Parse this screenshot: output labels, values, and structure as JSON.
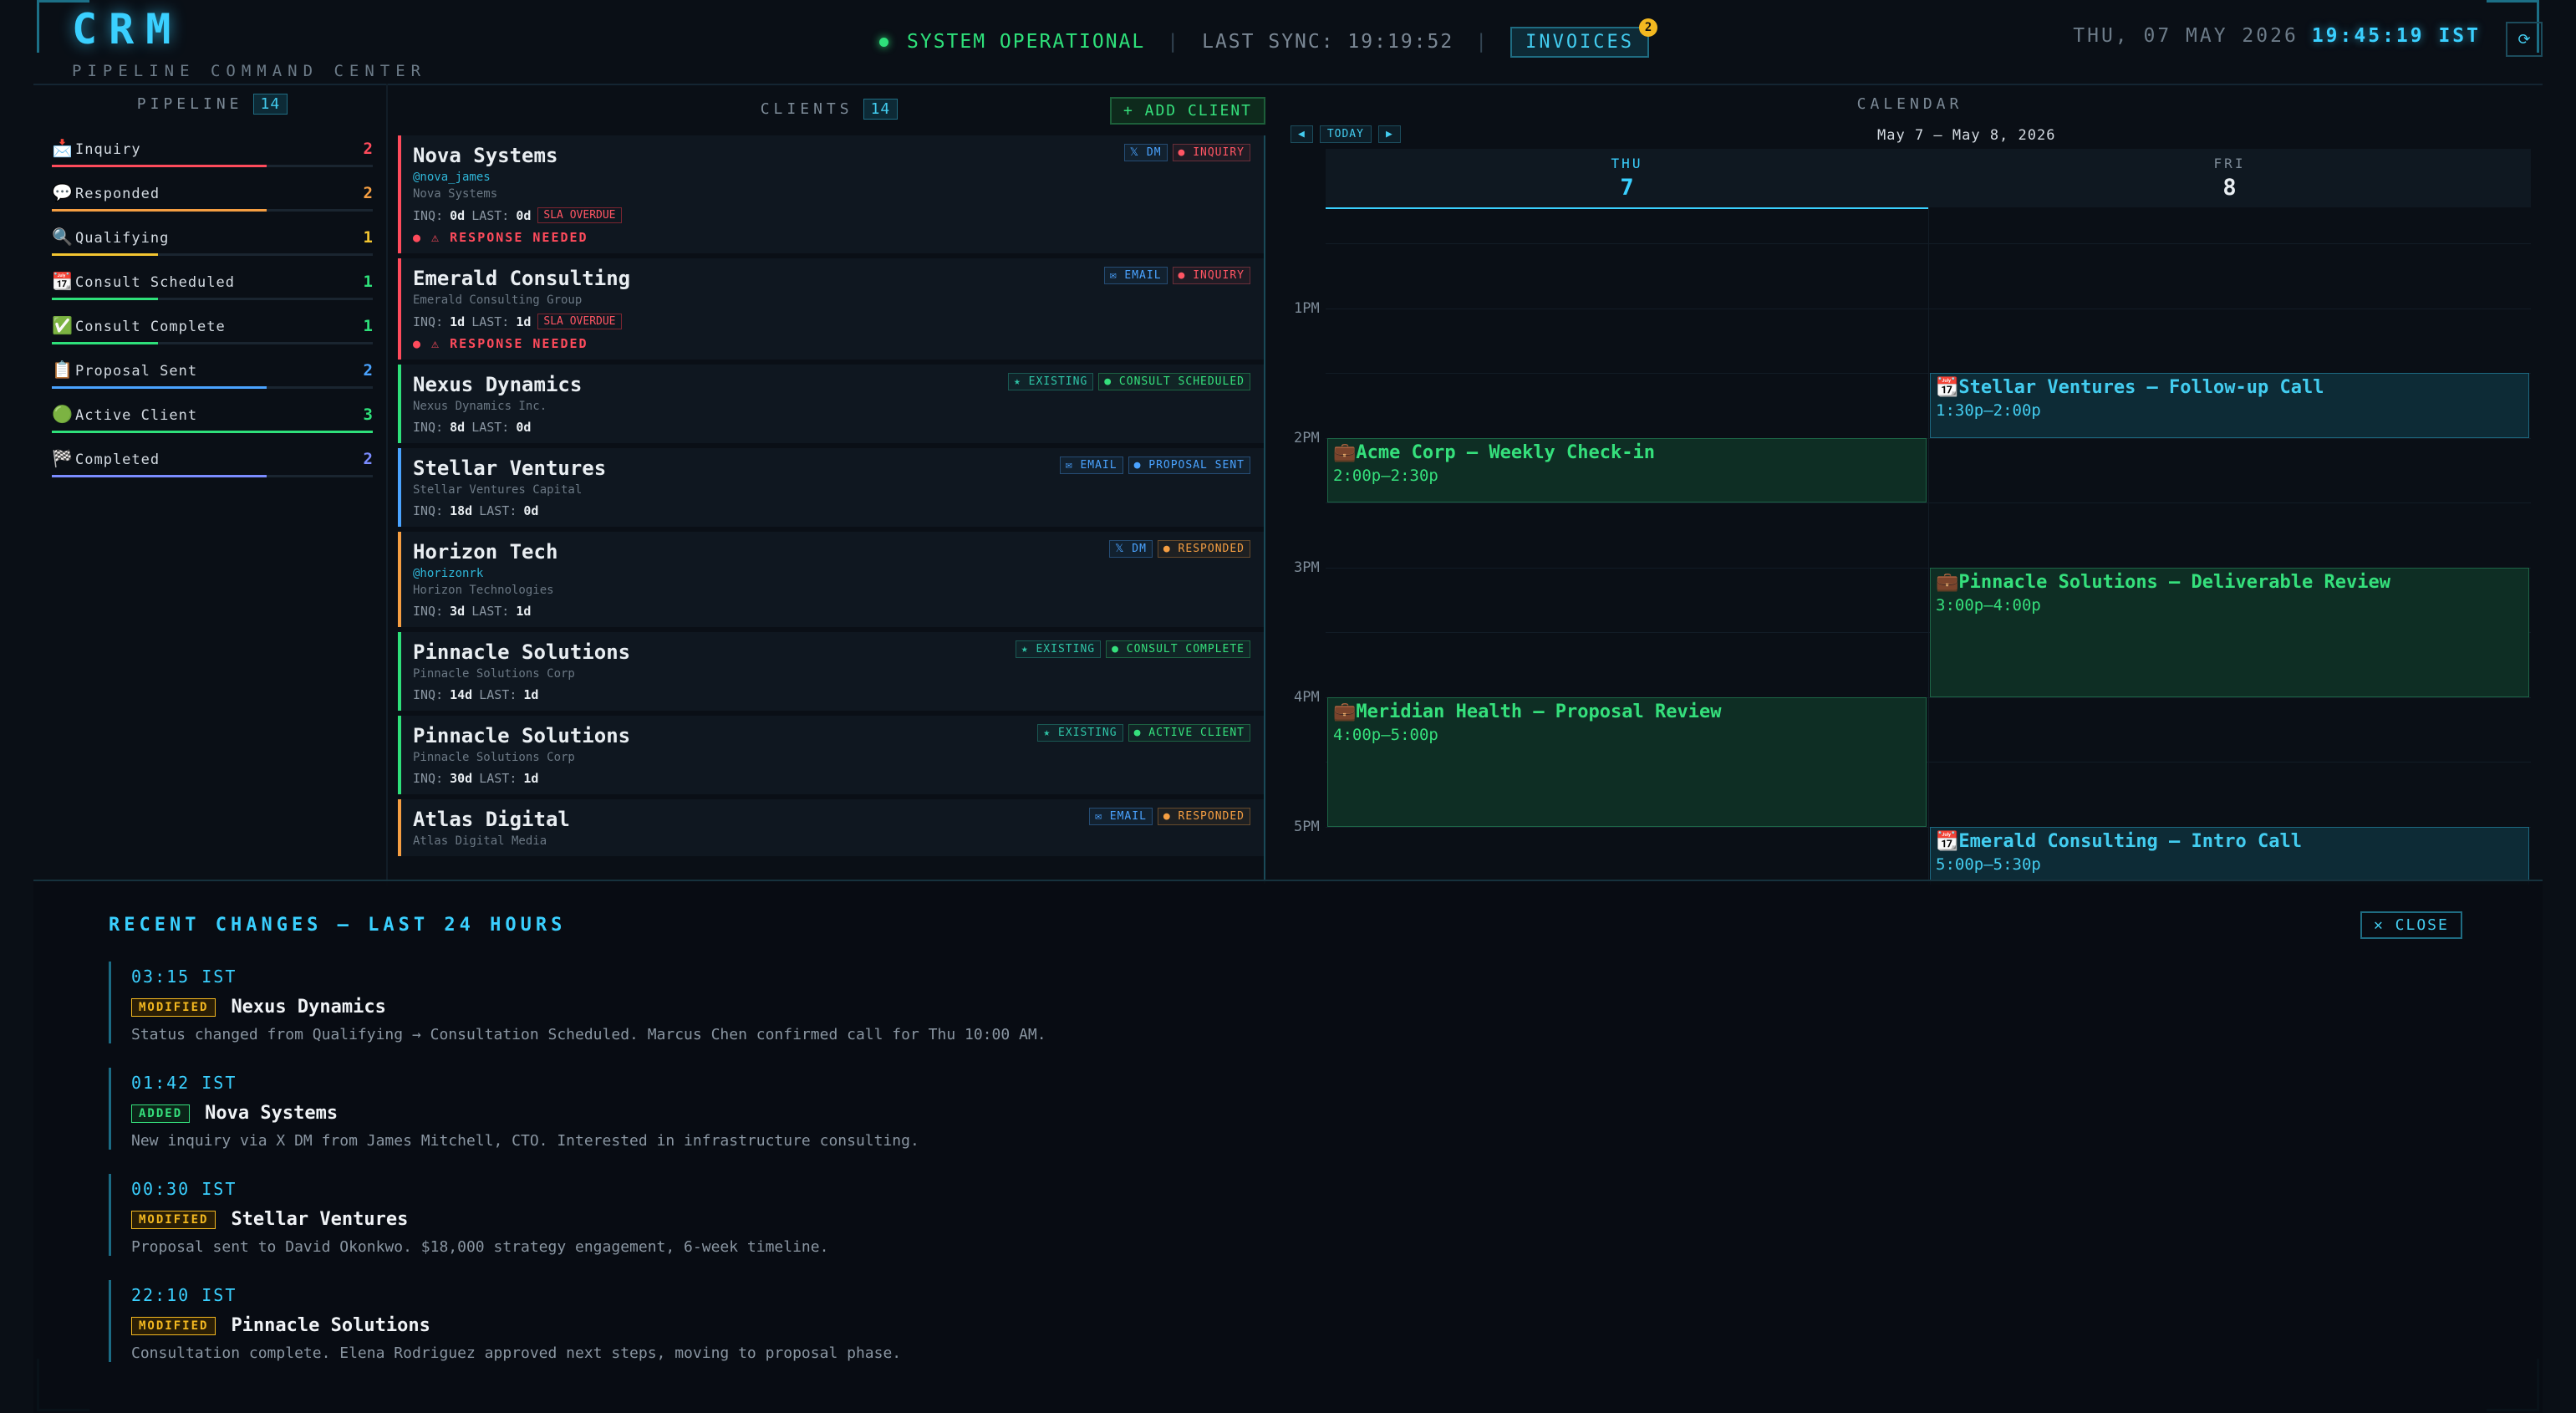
{
  "header": {
    "logo": "CRM",
    "subtitle": "PIPELINE COMMAND CENTER",
    "status": "SYSTEM OPERATIONAL",
    "last_sync": "LAST SYNC: 19:19:52",
    "invoices_label": "INVOICES",
    "invoices_badge": "2",
    "date": "THU, 07 MAY 2026",
    "time": "19:45:19 IST",
    "refresh_glyph": "⟳"
  },
  "pipeline": {
    "title": "PIPELINE",
    "count": "14",
    "stages": [
      {
        "icon": "📩",
        "name": "Inquiry",
        "count": "2",
        "color": "#ff4b5c",
        "fill": 0.67
      },
      {
        "icon": "💬",
        "name": "Responded",
        "count": "2",
        "color": "#f59e42",
        "fill": 0.67
      },
      {
        "icon": "🔍",
        "name": "Qualifying",
        "count": "1",
        "color": "#f3c531",
        "fill": 0.33
      },
      {
        "icon": "📆",
        "name": "Consult Scheduled",
        "count": "1",
        "color": "#2ee07a",
        "fill": 0.33
      },
      {
        "icon": "✅",
        "name": "Consult Complete",
        "count": "1",
        "color": "#2ee07a",
        "fill": 0.33
      },
      {
        "icon": "📋",
        "name": "Proposal Sent",
        "count": "2",
        "color": "#4aa3ff",
        "fill": 0.67
      },
      {
        "icon": "🟢",
        "name": "Active Client",
        "count": "3",
        "color": "#2ee07a",
        "fill": 1.0
      },
      {
        "icon": "🏁",
        "name": "Completed",
        "count": "2",
        "color": "#7b8cff",
        "fill": 0.67
      }
    ]
  },
  "clients": {
    "title": "CLIENTS",
    "count": "14",
    "add_label": "+ ADD CLIENT",
    "items": [
      {
        "name": "Nova Systems",
        "handle": "@nova_james",
        "company": "Nova Systems",
        "inq": "0d",
        "last": "0d",
        "sla": "SLA OVERDUE",
        "need": "● ⚠ RESPONSE NEEDED",
        "accent": "#ff4b5c",
        "channel": "𝕏 DM",
        "status": "● INQUIRY",
        "status_color": "#ff5563",
        "channel_color": "#4aa3ff"
      },
      {
        "name": "Emerald Consulting",
        "handle": "",
        "company": "Emerald Consulting Group",
        "inq": "1d",
        "last": "1d",
        "sla": "SLA OVERDUE",
        "need": "● ⚠ RESPONSE NEEDED",
        "accent": "#ff4b5c",
        "channel": "✉ EMAIL",
        "status": "● INQUIRY",
        "status_color": "#ff5563",
        "channel_color": "#4aa3ff"
      },
      {
        "name": "Nexus Dynamics",
        "handle": "",
        "company": "Nexus Dynamics Inc.",
        "inq": "8d",
        "last": "0d",
        "sla": "",
        "need": "",
        "accent": "#2ee07a",
        "channel": "★ EXISTING",
        "status": "● CONSULT SCHEDULED",
        "status_color": "#35e07c",
        "channel_color": "#2fc6a8"
      },
      {
        "name": "Stellar Ventures",
        "handle": "",
        "company": "Stellar Ventures Capital",
        "inq": "18d",
        "last": "0d",
        "sla": "",
        "need": "",
        "accent": "#4aa3ff",
        "channel": "✉ EMAIL",
        "status": "● PROPOSAL SENT",
        "status_color": "#4aa3ff",
        "channel_color": "#4aa3ff"
      },
      {
        "name": "Horizon Tech",
        "handle": "@horizonrk",
        "company": "Horizon Technologies",
        "inq": "3d",
        "last": "1d",
        "sla": "",
        "need": "",
        "accent": "#f59e42",
        "channel": "𝕏 DM",
        "status": "● RESPONDED",
        "status_color": "#f59e42",
        "channel_color": "#4aa3ff"
      },
      {
        "name": "Pinnacle Solutions",
        "handle": "",
        "company": "Pinnacle Solutions Corp",
        "inq": "14d",
        "last": "1d",
        "sla": "",
        "need": "",
        "accent": "#2ee07a",
        "channel": "★ EXISTING",
        "status": "● CONSULT COMPLETE",
        "status_color": "#35e07c",
        "channel_color": "#2fc6a8"
      },
      {
        "name": "Pinnacle Solutions",
        "handle": "",
        "company": "Pinnacle Solutions Corp",
        "inq": "30d",
        "last": "1d",
        "sla": "",
        "need": "",
        "accent": "#2ee07a",
        "channel": "★ EXISTING",
        "status": "● ACTIVE CLIENT",
        "status_color": "#35e07c",
        "channel_color": "#2fc6a8"
      },
      {
        "name": "Atlas Digital",
        "handle": "",
        "company": "Atlas Digital Media",
        "inq": "",
        "last": "",
        "sla": "",
        "need": "",
        "accent": "#f59e42",
        "channel": "✉ EMAIL",
        "status": "● RESPONDED",
        "status_color": "#f59e42",
        "channel_color": "#4aa3ff"
      }
    ]
  },
  "calendar": {
    "title": "CALENDAR",
    "prev": "◀",
    "today": "TODAY",
    "next": "▶",
    "range": "May 7 – May 8, 2026",
    "days": [
      {
        "name": "THU",
        "num": "7",
        "active": true
      },
      {
        "name": "FRI",
        "num": "8",
        "active": false
      }
    ],
    "hours": [
      "1PM",
      "2PM",
      "3PM",
      "4PM",
      "5PM"
    ],
    "events": [
      {
        "day": 1,
        "start": 13.5,
        "end": 14.0,
        "title": "📆Stellar Ventures — Follow-up Call",
        "time": "1:30p–2:00p",
        "kind": "cyan"
      },
      {
        "day": 0,
        "start": 14.0,
        "end": 14.5,
        "title": "💼Acme Corp — Weekly Check-in",
        "time": "2:00p–2:30p",
        "kind": "green"
      },
      {
        "day": 1,
        "start": 15.0,
        "end": 16.0,
        "title": "💼Pinnacle Solutions — Deliverable Review",
        "time": "3:00p–4:00p",
        "kind": "green"
      },
      {
        "day": 0,
        "start": 16.0,
        "end": 17.0,
        "title": "💼Meridian Health — Proposal Review",
        "time": "4:00p–5:00p",
        "kind": "green"
      },
      {
        "day": 1,
        "start": 17.0,
        "end": 17.5,
        "title": "📆Emerald Consulting — Intro Call",
        "time": "5:00p–5:30p",
        "kind": "cyan"
      }
    ]
  },
  "changes": {
    "title": "RECENT CHANGES — LAST 24 HOURS",
    "close_label": "✕ CLOSE",
    "items": [
      {
        "time": "03:15 IST",
        "kind": "MODIFIED",
        "name": "Nexus Dynamics",
        "desc": "Status changed from Qualifying → Consultation Scheduled. Marcus Chen confirmed call for Thu 10:00 AM."
      },
      {
        "time": "01:42 IST",
        "kind": "ADDED",
        "name": "Nova Systems",
        "desc": "New inquiry via X DM from James Mitchell, CTO. Interested in infrastructure consulting."
      },
      {
        "time": "00:30 IST",
        "kind": "MODIFIED",
        "name": "Stellar Ventures",
        "desc": "Proposal sent to David Okonkwo. $18,000 strategy engagement, 6-week timeline."
      },
      {
        "time": "22:10 IST",
        "kind": "MODIFIED",
        "name": "Pinnacle Solutions",
        "desc": "Consultation complete. Elena Rodriguez approved next steps, moving to proposal phase."
      }
    ]
  }
}
